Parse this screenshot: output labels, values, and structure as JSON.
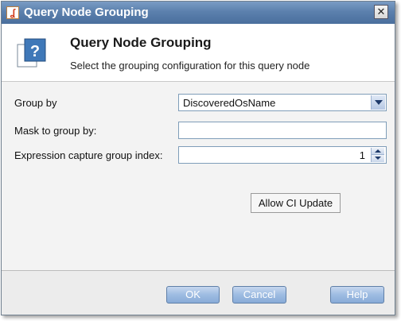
{
  "window": {
    "title": "Query Node Grouping",
    "close_glyph": "✕",
    "app_icon": "java-icon"
  },
  "header": {
    "icon": "help-question-icon",
    "title": "Query Node Grouping",
    "subtitle": "Select the grouping configuration for this query node"
  },
  "form": {
    "group_by_label": "Group by",
    "group_by_value": "DiscoveredOsName",
    "mask_label": "Mask to group by:",
    "mask_value": "",
    "capture_label": "Expression capture group index:",
    "capture_value": "1",
    "allow_ci_update_label": "Allow CI Update"
  },
  "footer": {
    "ok_label": "OK",
    "cancel_label": "Cancel",
    "help_label": "Help"
  },
  "colors": {
    "titlebar": "#5b80ad",
    "button_blue": "#9ebce2"
  }
}
